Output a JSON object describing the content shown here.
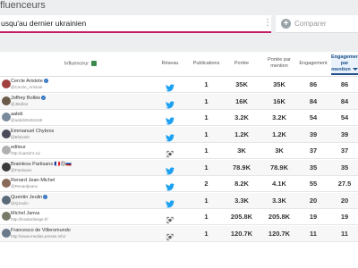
{
  "header": {
    "title": "fluenceurs"
  },
  "search": {
    "query": "usqu'au dernier ukrainien"
  },
  "compare": {
    "label": "Comparer"
  },
  "table": {
    "columns": {
      "influencer": "Influenceur",
      "network": "Réseau",
      "publications": "Publications",
      "reach": "Portée",
      "reach_per_mention": "Portée par mention",
      "engagement": "Engagement",
      "engagement_per_mention": "Engagement par mention"
    },
    "rows": [
      {
        "name": "Cercle Aristote",
        "handle": "@Cercle_Aristote",
        "verified": true,
        "network": "twitter",
        "publications": "1",
        "reach": "35K",
        "reach_per_mention": "35K",
        "engagement": "86",
        "engagement_per_mention": "86",
        "avatar_color": "#a04040"
      },
      {
        "name": "Joffrey Bollée",
        "handle": "@JBollee",
        "verified": true,
        "network": "twitter",
        "publications": "1",
        "reach": "16K",
        "reach_per_mention": "16K",
        "engagement": "84",
        "engagement_per_mention": "84",
        "avatar_color": "#6a5a4a"
      },
      {
        "name": "aabdi",
        "handle": "@aabdi26451159",
        "verified": false,
        "network": "twitter",
        "publications": "1",
        "reach": "3.2K",
        "reach_per_mention": "3.2K",
        "engagement": "54",
        "engagement_per_mention": "54",
        "avatar_color": "#7a8a9a"
      },
      {
        "name": "Emmanuel Chybros",
        "handle": "@Bfolveth",
        "verified": false,
        "network": "twitter",
        "publications": "1",
        "reach": "1.2K",
        "reach_per_mention": "1.2K",
        "engagement": "39",
        "engagement_per_mention": "39",
        "avatar_color": "#4a4a5a"
      },
      {
        "name": "editeur",
        "handle": "http://uastin's.ru/",
        "verified": false,
        "network": "web",
        "publications": "1",
        "reach": "3K",
        "reach_per_mention": "3K",
        "engagement": "37",
        "engagement_per_mention": "37",
        "avatar_color": "#b0b0b0"
      },
      {
        "name": "Brainless Partisans 🇫🇷😊🇷🇺",
        "handle": "@Partisans",
        "verified": false,
        "network": "twitter",
        "publications": "1",
        "reach": "78.9K",
        "reach_per_mention": "78.9K",
        "engagement": "35",
        "engagement_per_mention": "35",
        "avatar_color": "#3a3a3a"
      },
      {
        "name": "Renard Jean-Michel",
        "handle": "@Renardjeanv",
        "verified": false,
        "network": "twitter",
        "publications": "2",
        "reach": "8.2K",
        "reach_per_mention": "4.1K",
        "engagement": "55",
        "engagement_per_mention": "27.5",
        "avatar_color": "#8a6a5a"
      },
      {
        "name": "Quentin Jeulin",
        "handle": "@QJeulin",
        "verified": true,
        "network": "twitter",
        "publications": "1",
        "reach": "3.3K",
        "reach_per_mention": "3.3K",
        "engagement": "20",
        "engagement_per_mention": "20",
        "avatar_color": "#5a6a7a"
      },
      {
        "name": "Michel Janva",
        "handle": "http://lesalonbeige.fr/",
        "verified": false,
        "network": "web",
        "publications": "1",
        "reach": "205.8K",
        "reach_per_mention": "205.8K",
        "engagement": "19",
        "engagement_per_mention": "19",
        "avatar_color": "#7a7a6a"
      },
      {
        "name": "Francesco de Villeromundo",
        "handle": "http://www.medias-presse.info/",
        "verified": false,
        "network": "web",
        "publications": "1",
        "reach": "120.7K",
        "reach_per_mention": "120.7K",
        "engagement": "11",
        "engagement_per_mention": "11",
        "avatar_color": "#6a7a8a"
      }
    ]
  }
}
